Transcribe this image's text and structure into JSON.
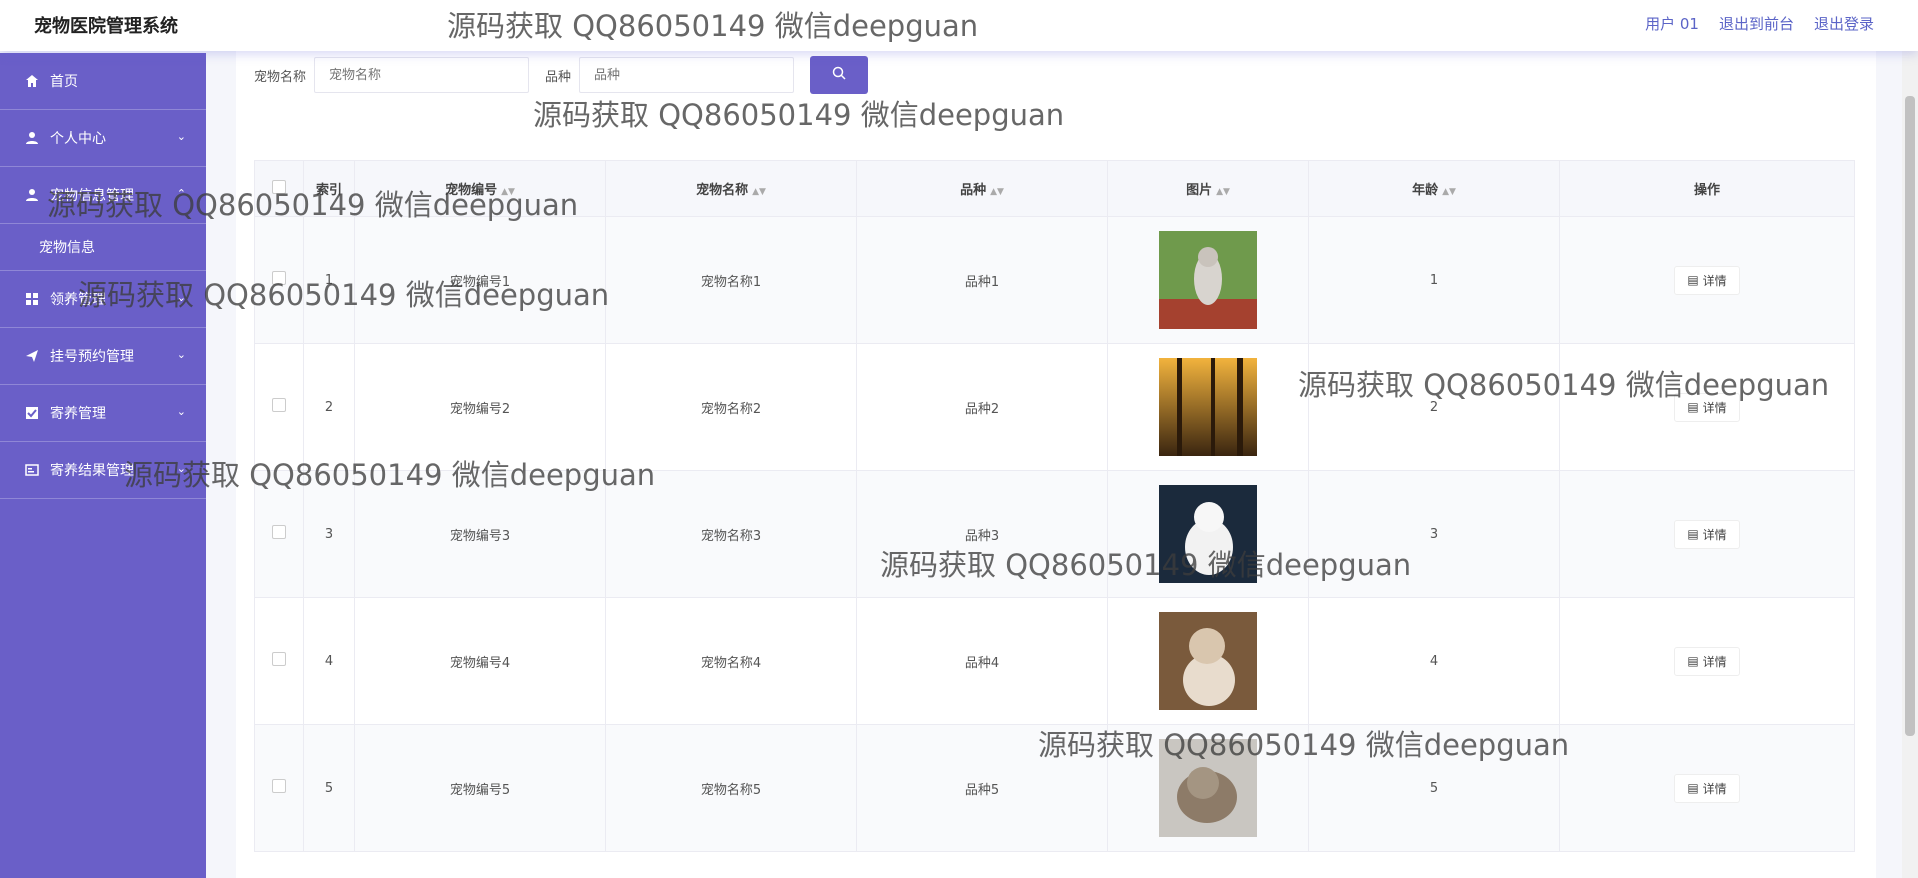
{
  "app": {
    "title": "宠物医院管理系统"
  },
  "topbar": {
    "user": "用户 01",
    "to_front": "退出到前台",
    "logout": "退出登录"
  },
  "sidebar": {
    "items": [
      {
        "label": "首页",
        "icon": "home-icon"
      },
      {
        "label": "个人中心",
        "icon": "user-icon"
      },
      {
        "label": "宠物信息管理",
        "icon": "user-icon"
      },
      {
        "label": "领养管理",
        "icon": "grid-icon"
      },
      {
        "label": "挂号预约管理",
        "icon": "send-icon"
      },
      {
        "label": "寄养管理",
        "icon": "checkbox-icon"
      },
      {
        "label": "寄养结果管理",
        "icon": "card-icon"
      }
    ],
    "sub_item": "宠物信息"
  },
  "search": {
    "name_label": "宠物名称",
    "name_placeholder": "宠物名称",
    "breed_label": "品种",
    "breed_placeholder": "品种"
  },
  "table": {
    "headers": {
      "index": "索引",
      "code": "宠物编号",
      "name": "宠物名称",
      "breed": "品种",
      "image": "图片",
      "age": "年龄",
      "action": "操作"
    },
    "rows": [
      {
        "index": "1",
        "code": "宠物编号1",
        "name": "宠物名称1",
        "breed": "品种1",
        "age": "1",
        "action": "详情"
      },
      {
        "index": "2",
        "code": "宠物编号2",
        "name": "宠物名称2",
        "breed": "品种2",
        "age": "2",
        "action": "详情"
      },
      {
        "index": "3",
        "code": "宠物编号3",
        "name": "宠物名称3",
        "breed": "品种3",
        "age": "3",
        "action": "详情"
      },
      {
        "index": "4",
        "code": "宠物编号4",
        "name": "宠物名称4",
        "breed": "品种4",
        "age": "4",
        "action": "详情"
      },
      {
        "index": "5",
        "code": "宠物编号5",
        "name": "宠物名称5",
        "breed": "品种5",
        "age": "5",
        "action": "详情"
      }
    ]
  },
  "watermark": "源码获取 QQ86050149 微信deepguan",
  "colors": {
    "primary": "#6a5fc8",
    "sidebar": "#6a5fc8"
  }
}
